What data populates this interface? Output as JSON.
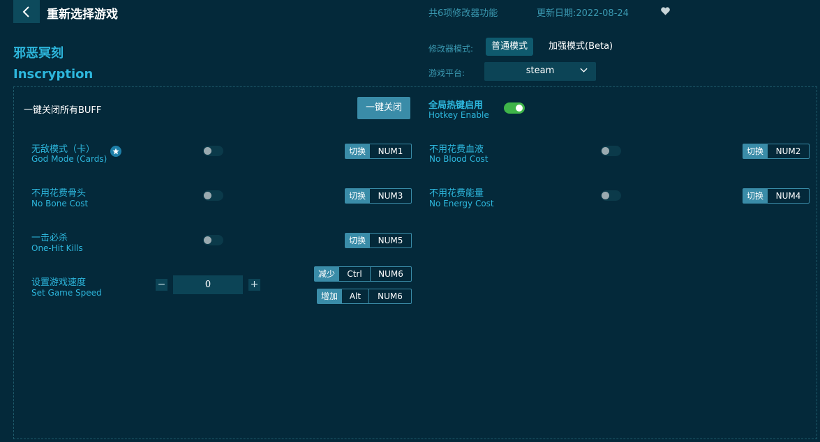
{
  "header": {
    "title": "重新选择游戏",
    "feature_count": "共6项修改器功能",
    "update_date": "更新日期:2022-08-24"
  },
  "game": {
    "name_cn": "邪恶冥刻",
    "name_en": "Inscryption"
  },
  "mode": {
    "label": "修改器模式:",
    "normal": "普通模式",
    "beta": "加强模式(Beta)"
  },
  "platform": {
    "label": "游戏平台:",
    "value": "steam"
  },
  "buff": {
    "label": "一键关闭所有BUFF",
    "button": "一键关闭"
  },
  "hotkey": {
    "label_cn": "全局热键启用",
    "label_en": "Hotkey Enable",
    "enabled": true
  },
  "options": [
    {
      "cn": "无敌模式（卡）",
      "en": "God Mode (Cards)",
      "tag": "切换",
      "key": "NUM1",
      "on": false
    },
    {
      "cn": "不用花费血液",
      "en": "No Blood Cost",
      "tag": "切换",
      "key": "NUM2",
      "on": false
    },
    {
      "cn": "不用花费骨头",
      "en": "No Bone Cost",
      "tag": "切换",
      "key": "NUM3",
      "on": false
    },
    {
      "cn": "不用花费能量",
      "en": "No Energy Cost",
      "tag": "切换",
      "key": "NUM4",
      "on": false
    },
    {
      "cn": "一击必杀",
      "en": "One-Hit Kills",
      "tag": "切换",
      "key": "NUM5",
      "on": false
    }
  ],
  "speed": {
    "cn": "设置游戏速度",
    "en": "Set Game Speed",
    "value": "0",
    "minus": "−",
    "plus": "+",
    "dec_tag": "减少",
    "dec_mod": "Ctrl",
    "dec_key": "NUM6",
    "inc_tag": "增加",
    "inc_mod": "Alt",
    "inc_key": "NUM6"
  },
  "colors": {
    "background": "#04293a",
    "accent": "#2db6dc",
    "toggle_on": "#3fb449"
  }
}
